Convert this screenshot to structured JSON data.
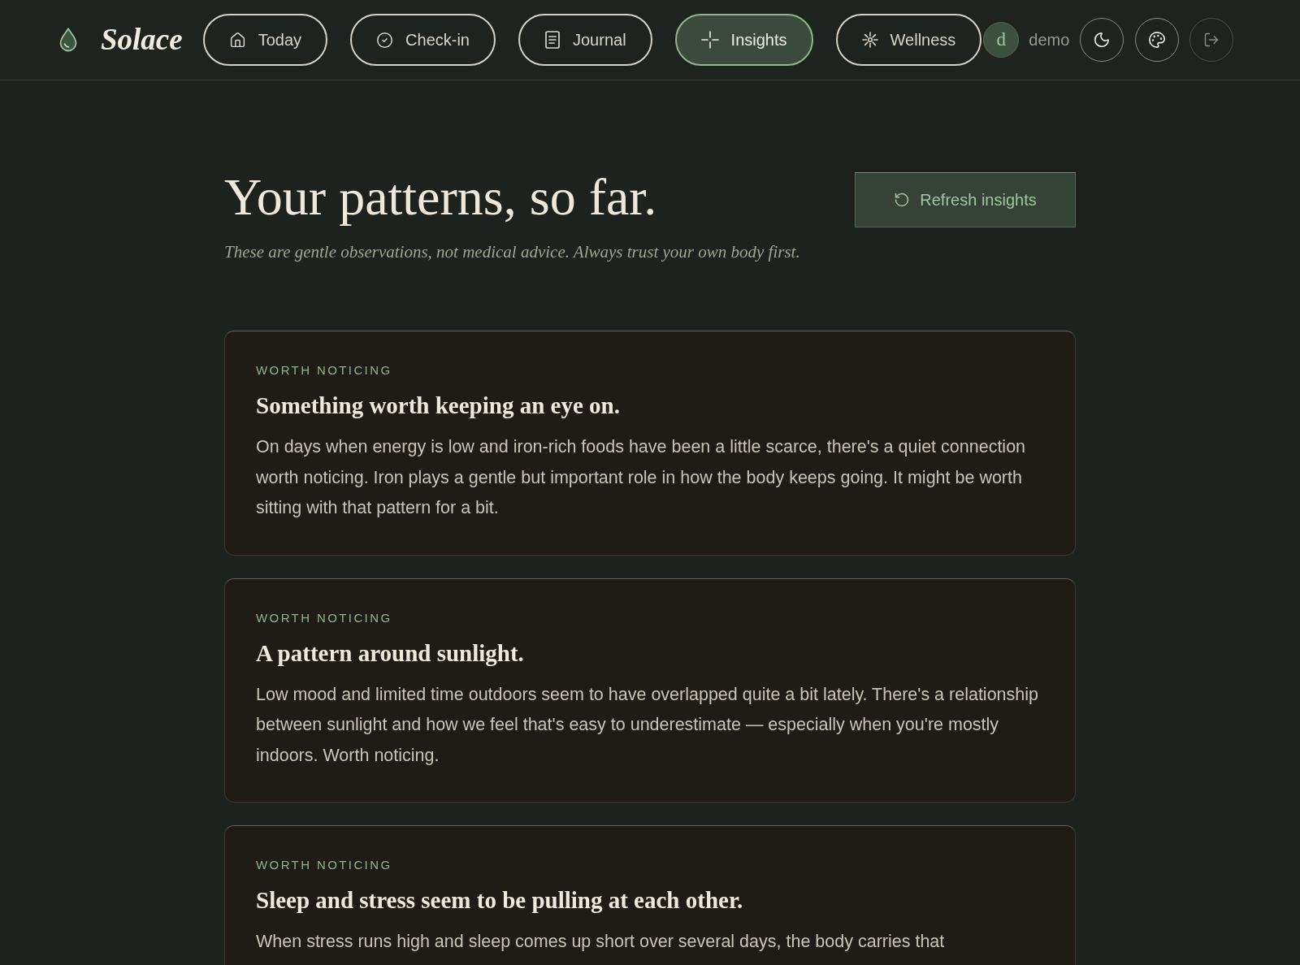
{
  "header": {
    "brand": "Solace",
    "nav": [
      {
        "label": "Today",
        "selected": false
      },
      {
        "label": "Check-in",
        "selected": false
      },
      {
        "label": "Journal",
        "selected": false
      },
      {
        "label": "Insights",
        "selected": true
      },
      {
        "label": "Wellness",
        "selected": false
      }
    ],
    "user": {
      "initial": "d",
      "name": "demo"
    }
  },
  "page": {
    "title": "Your patterns, so far.",
    "subtitle": "These are gentle observations, not medical advice. Always trust your own body first.",
    "refresh_button": "Refresh insights"
  },
  "insights": [
    {
      "label": "WORTH NOTICING",
      "title": "Something worth keeping an eye on.",
      "body": "On days when energy is low and iron-rich foods have been a little scarce, there's a quiet connection worth noticing. Iron plays a gentle but important role in how the body keeps going. It might be worth sitting with that pattern for a bit."
    },
    {
      "label": "WORTH NOTICING",
      "title": "A pattern around sunlight.",
      "body": "Low mood and limited time outdoors seem to have overlapped quite a bit lately. There's a relationship between sunlight and how we feel that's easy to underestimate — especially when you're mostly indoors. Worth noticing."
    },
    {
      "label": "WORTH NOTICING",
      "title": "Sleep and stress seem to be pulling at each other.",
      "body": "When stress runs high and sleep comes up short over several days, the body carries that"
    }
  ]
}
